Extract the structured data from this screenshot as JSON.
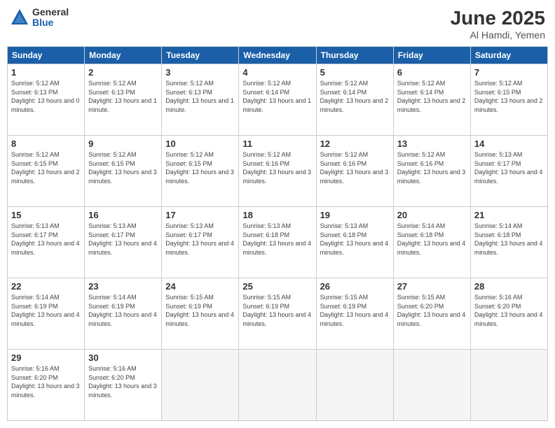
{
  "logo": {
    "general": "General",
    "blue": "Blue"
  },
  "header": {
    "title": "June 2025",
    "subtitle": "Al Hamdi, Yemen"
  },
  "weekdays": [
    "Sunday",
    "Monday",
    "Tuesday",
    "Wednesday",
    "Thursday",
    "Friday",
    "Saturday"
  ],
  "weeks": [
    [
      {
        "day": "1",
        "sunrise": "5:12 AM",
        "sunset": "6:13 PM",
        "daylight": "13 hours and 0 minutes."
      },
      {
        "day": "2",
        "sunrise": "5:12 AM",
        "sunset": "6:13 PM",
        "daylight": "13 hours and 1 minute."
      },
      {
        "day": "3",
        "sunrise": "5:12 AM",
        "sunset": "6:13 PM",
        "daylight": "13 hours and 1 minute."
      },
      {
        "day": "4",
        "sunrise": "5:12 AM",
        "sunset": "6:14 PM",
        "daylight": "13 hours and 1 minute."
      },
      {
        "day": "5",
        "sunrise": "5:12 AM",
        "sunset": "6:14 PM",
        "daylight": "13 hours and 2 minutes."
      },
      {
        "day": "6",
        "sunrise": "5:12 AM",
        "sunset": "6:14 PM",
        "daylight": "13 hours and 2 minutes."
      },
      {
        "day": "7",
        "sunrise": "5:12 AM",
        "sunset": "6:15 PM",
        "daylight": "13 hours and 2 minutes."
      }
    ],
    [
      {
        "day": "8",
        "sunrise": "5:12 AM",
        "sunset": "6:15 PM",
        "daylight": "13 hours and 2 minutes."
      },
      {
        "day": "9",
        "sunrise": "5:12 AM",
        "sunset": "6:15 PM",
        "daylight": "13 hours and 3 minutes."
      },
      {
        "day": "10",
        "sunrise": "5:12 AM",
        "sunset": "6:15 PM",
        "daylight": "13 hours and 3 minutes."
      },
      {
        "day": "11",
        "sunrise": "5:12 AM",
        "sunset": "6:16 PM",
        "daylight": "13 hours and 3 minutes."
      },
      {
        "day": "12",
        "sunrise": "5:12 AM",
        "sunset": "6:16 PM",
        "daylight": "13 hours and 3 minutes."
      },
      {
        "day": "13",
        "sunrise": "5:12 AM",
        "sunset": "6:16 PM",
        "daylight": "13 hours and 3 minutes."
      },
      {
        "day": "14",
        "sunrise": "5:13 AM",
        "sunset": "6:17 PM",
        "daylight": "13 hours and 4 minutes."
      }
    ],
    [
      {
        "day": "15",
        "sunrise": "5:13 AM",
        "sunset": "6:17 PM",
        "daylight": "13 hours and 4 minutes."
      },
      {
        "day": "16",
        "sunrise": "5:13 AM",
        "sunset": "6:17 PM",
        "daylight": "13 hours and 4 minutes."
      },
      {
        "day": "17",
        "sunrise": "5:13 AM",
        "sunset": "6:17 PM",
        "daylight": "13 hours and 4 minutes."
      },
      {
        "day": "18",
        "sunrise": "5:13 AM",
        "sunset": "6:18 PM",
        "daylight": "13 hours and 4 minutes."
      },
      {
        "day": "19",
        "sunrise": "5:13 AM",
        "sunset": "6:18 PM",
        "daylight": "13 hours and 4 minutes."
      },
      {
        "day": "20",
        "sunrise": "5:14 AM",
        "sunset": "6:18 PM",
        "daylight": "13 hours and 4 minutes."
      },
      {
        "day": "21",
        "sunrise": "5:14 AM",
        "sunset": "6:18 PM",
        "daylight": "13 hours and 4 minutes."
      }
    ],
    [
      {
        "day": "22",
        "sunrise": "5:14 AM",
        "sunset": "6:19 PM",
        "daylight": "13 hours and 4 minutes."
      },
      {
        "day": "23",
        "sunrise": "5:14 AM",
        "sunset": "6:19 PM",
        "daylight": "13 hours and 4 minutes."
      },
      {
        "day": "24",
        "sunrise": "5:15 AM",
        "sunset": "6:19 PM",
        "daylight": "13 hours and 4 minutes."
      },
      {
        "day": "25",
        "sunrise": "5:15 AM",
        "sunset": "6:19 PM",
        "daylight": "13 hours and 4 minutes."
      },
      {
        "day": "26",
        "sunrise": "5:15 AM",
        "sunset": "6:19 PM",
        "daylight": "13 hours and 4 minutes."
      },
      {
        "day": "27",
        "sunrise": "5:15 AM",
        "sunset": "6:20 PM",
        "daylight": "13 hours and 4 minutes."
      },
      {
        "day": "28",
        "sunrise": "5:16 AM",
        "sunset": "6:20 PM",
        "daylight": "13 hours and 4 minutes."
      }
    ],
    [
      {
        "day": "29",
        "sunrise": "5:16 AM",
        "sunset": "6:20 PM",
        "daylight": "13 hours and 3 minutes."
      },
      {
        "day": "30",
        "sunrise": "5:16 AM",
        "sunset": "6:20 PM",
        "daylight": "13 hours and 3 minutes."
      },
      null,
      null,
      null,
      null,
      null
    ]
  ]
}
